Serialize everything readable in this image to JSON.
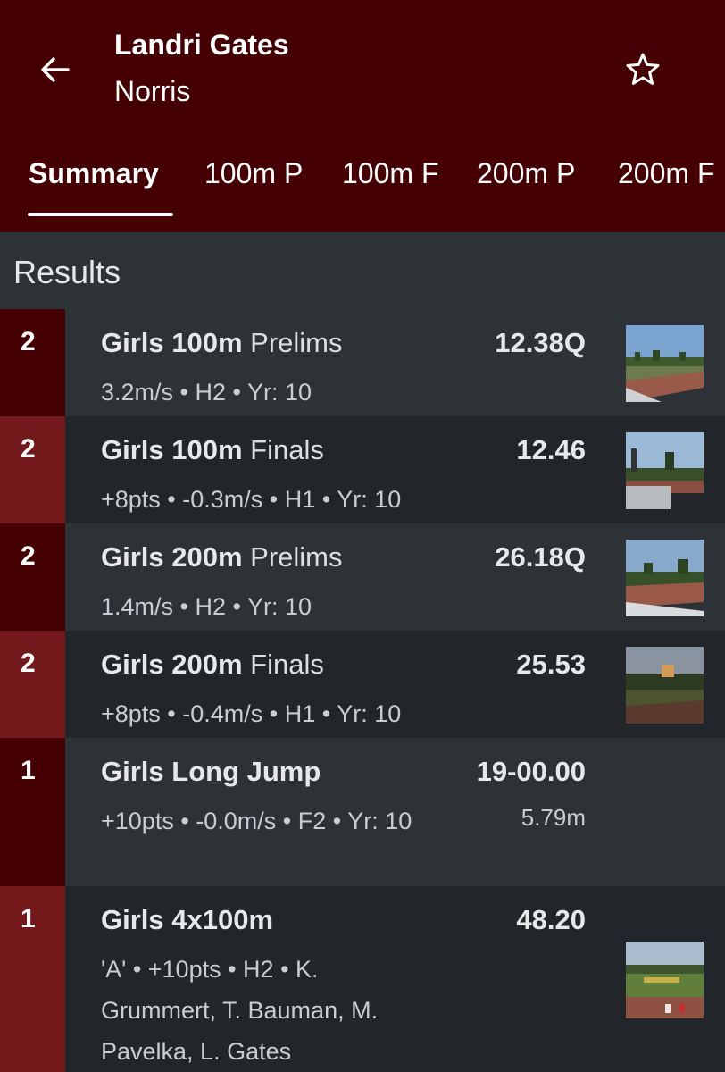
{
  "header": {
    "title": "Landri Gates",
    "subtitle": "Norris",
    "back_icon": "arrow-left-icon",
    "favorite_icon": "star-outline-icon"
  },
  "tabs": [
    {
      "label": "Summary",
      "active": true
    },
    {
      "label": "100m P",
      "active": false
    },
    {
      "label": "100m F",
      "active": false
    },
    {
      "label": "200m P",
      "active": false
    },
    {
      "label": "200m F",
      "active": false
    }
  ],
  "section": {
    "title": "Results"
  },
  "results": [
    {
      "place": "2",
      "event_bold": "Girls 100m",
      "event_rest": " Prelims",
      "mark": "12.38Q",
      "mark2": "",
      "details": "3.2m/s • H2 • Yr: 10",
      "has_photo": true
    },
    {
      "place": "2",
      "event_bold": "Girls 100m",
      "event_rest": " Finals",
      "mark": "12.46",
      "mark2": "",
      "details": "+8pts • -0.3m/s • H1 • Yr: 10",
      "has_photo": true
    },
    {
      "place": "2",
      "event_bold": "Girls 200m",
      "event_rest": " Prelims",
      "mark": "26.18Q",
      "mark2": "",
      "details": "1.4m/s • H2 • Yr: 10",
      "has_photo": true
    },
    {
      "place": "2",
      "event_bold": "Girls 200m",
      "event_rest": " Finals",
      "mark": "25.53",
      "mark2": "",
      "details": "+8pts • -0.4m/s • H1 • Yr: 10",
      "has_photo": true
    },
    {
      "place": "1",
      "event_bold": "Girls Long Jump",
      "event_rest": "",
      "mark": "19-00.00",
      "mark2": "5.79m",
      "details": "+10pts • -0.0m/s • F2 • Yr: 10",
      "has_photo": false
    },
    {
      "place": "1",
      "event_bold": "Girls 4x100m",
      "event_rest": "",
      "mark": "48.20",
      "mark2": "",
      "details": "'A' • +10pts • H2 • K. Grummert, T. Bauman, M. Pavelka, L. Gates",
      "has_photo": true
    }
  ],
  "colors": {
    "header_bg": "#440003",
    "place_dark": "#440003",
    "place_light": "#74191b",
    "row_even": "#2d3237",
    "row_odd": "#22262a"
  }
}
